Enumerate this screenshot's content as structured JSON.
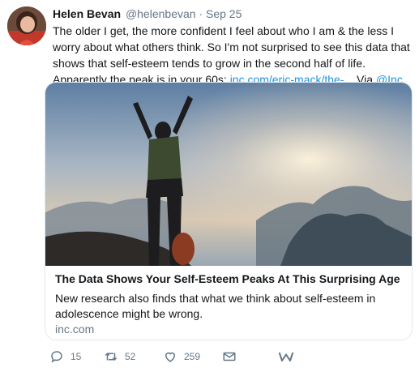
{
  "tweet": {
    "author_name": "Helen Bevan",
    "handle_date": "@helenbevan · Sep 25",
    "text_main": "The older I get, the more confident I feel about who I am & the less I worry about what others think. So I'm not surprised to see this data that shows that self-esteem tends to grow in the second half of life. Apparently the peak is in your 60s: ",
    "link_text": "inc.com/eric-mack/the-...",
    "via_text": " Via ",
    "via_mention": "@Inc"
  },
  "card": {
    "title": "The Data Shows Your Self-Esteem Peaks At This Surprising Age",
    "description": "New research also finds that what we think about self-esteem in adolescence might be wrong.",
    "domain": "inc.com"
  },
  "actions": {
    "reply_count": "15",
    "retweet_count": "52",
    "like_count": "259"
  },
  "icons": {
    "reply": "reply-icon",
    "retweet": "retweet-icon",
    "like": "heart-icon",
    "dm": "envelope-icon",
    "extra": "w-extension-icon"
  },
  "colors": {
    "link": "#1b95e0",
    "secondary_text": "#657786",
    "border": "#e1e8ed"
  }
}
